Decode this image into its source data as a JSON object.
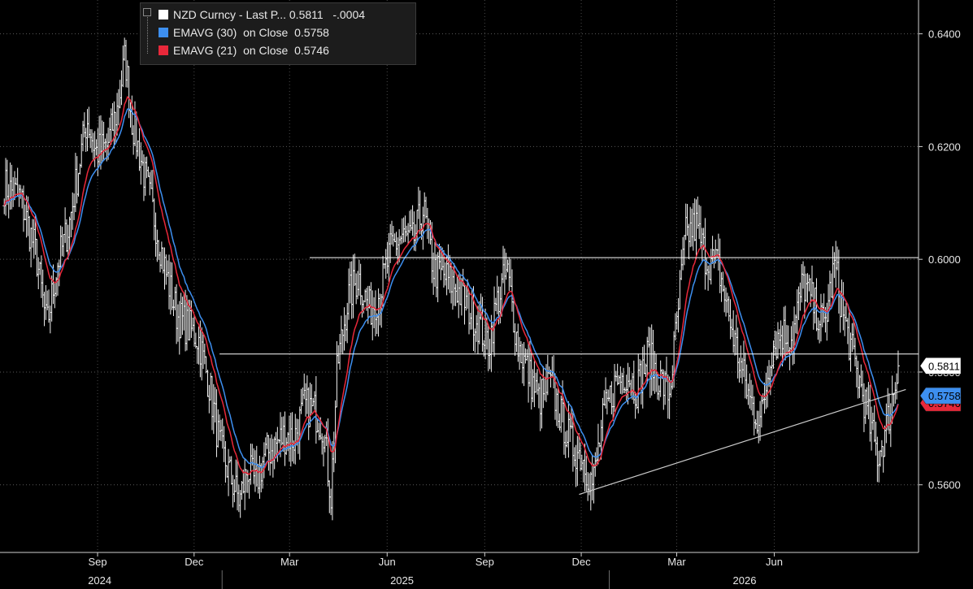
{
  "legend": {
    "items": [
      {
        "label": "NZD Curncy - Last P... 0.5811   -.0004",
        "color": "#ffffff"
      },
      {
        "label": "EMAVG (30)  on Close  0.5758",
        "color": "#3d8ff0"
      },
      {
        "label": "EMAVG (21)  on Close  0.5746",
        "color": "#e8283a"
      }
    ]
  },
  "chart_data": {
    "type": "line",
    "title": "",
    "xlabel": "",
    "ylabel": "",
    "ylim": [
      0.548,
      0.646
    ],
    "yticks": [
      "0.6400",
      "0.6200",
      "0.6000",
      "0.5800",
      "0.5600"
    ],
    "ytick_values": [
      0.64,
      0.62,
      0.6,
      0.58,
      0.56
    ],
    "xticks": [
      "Sep",
      "Dec",
      "Mar",
      "Jun",
      "Sep",
      "Dec",
      "Mar",
      "Jun"
    ],
    "years": [
      "2024",
      "2025",
      "2026"
    ],
    "grid": true,
    "last_labels": [
      {
        "text": "0.5811",
        "value": 0.5811,
        "bg": "#ffffff",
        "fg": "#000000"
      },
      {
        "text": "0.5758",
        "value": 0.5758,
        "bg": "#3d8ff0",
        "fg": "#000000"
      },
      {
        "text": "0.5746",
        "value": 0.5745,
        "bg": "#e8283a",
        "fg": "#000000"
      }
    ],
    "price_path": [
      [
        "2024-06-05",
        0.613
      ],
      [
        "2024-06-20",
        0.611
      ],
      [
        "2024-07-05",
        0.601
      ],
      [
        "2024-07-15",
        0.588
      ],
      [
        "2024-07-25",
        0.599
      ],
      [
        "2024-08-05",
        0.606
      ],
      [
        "2024-08-12",
        0.614
      ],
      [
        "2024-08-22",
        0.625
      ],
      [
        "2024-08-30",
        0.619
      ],
      [
        "2024-09-10",
        0.62
      ],
      [
        "2024-09-20",
        0.627
      ],
      [
        "2024-09-27",
        0.636
      ],
      [
        "2024-10-03",
        0.625
      ],
      [
        "2024-10-15",
        0.615
      ],
      [
        "2024-10-25",
        0.607
      ],
      [
        "2024-11-05",
        0.597
      ],
      [
        "2024-11-15",
        0.59
      ],
      [
        "2024-11-25",
        0.588
      ],
      [
        "2024-12-05",
        0.586
      ],
      [
        "2024-12-15",
        0.578
      ],
      [
        "2024-12-25",
        0.567
      ],
      [
        "2025-01-05",
        0.561
      ],
      [
        "2025-01-13",
        0.557
      ],
      [
        "2025-01-20",
        0.563
      ],
      [
        "2025-01-28",
        0.56
      ],
      [
        "2025-02-05",
        0.565
      ],
      [
        "2025-02-15",
        0.567
      ],
      [
        "2025-02-25",
        0.569
      ],
      [
        "2025-03-05",
        0.568
      ],
      [
        "2025-03-15",
        0.574
      ],
      [
        "2025-03-25",
        0.573
      ],
      [
        "2025-04-02",
        0.57
      ],
      [
        "2025-04-09",
        0.558
      ],
      [
        "2025-04-15",
        0.581
      ],
      [
        "2025-04-25",
        0.593
      ],
      [
        "2025-05-05",
        0.597
      ],
      [
        "2025-05-15",
        0.591
      ],
      [
        "2025-05-25",
        0.594
      ],
      [
        "2025-06-05",
        0.602
      ],
      [
        "2025-06-15",
        0.604
      ],
      [
        "2025-06-25",
        0.603
      ],
      [
        "2025-07-05",
        0.609
      ],
      [
        "2025-07-15",
        0.598
      ],
      [
        "2025-07-25",
        0.597
      ],
      [
        "2025-08-05",
        0.595
      ],
      [
        "2025-08-15",
        0.592
      ],
      [
        "2025-08-25",
        0.589
      ],
      [
        "2025-09-05",
        0.585
      ],
      [
        "2025-09-12",
        0.592
      ],
      [
        "2025-09-22",
        0.598
      ],
      [
        "2025-10-02",
        0.585
      ],
      [
        "2025-10-12",
        0.58
      ],
      [
        "2025-10-22",
        0.575
      ],
      [
        "2025-11-02",
        0.578
      ],
      [
        "2025-11-12",
        0.572
      ],
      [
        "2025-11-22",
        0.567
      ],
      [
        "2025-12-02",
        0.565
      ],
      [
        "2025-12-12",
        0.56
      ],
      [
        "2025-12-22",
        0.572
      ],
      [
        "2026-01-02",
        0.578
      ],
      [
        "2026-01-12",
        0.58
      ],
      [
        "2026-01-22",
        0.577
      ],
      [
        "2026-02-02",
        0.583
      ],
      [
        "2026-02-12",
        0.579
      ],
      [
        "2026-02-22",
        0.576
      ],
      [
        "2026-03-02",
        0.59
      ],
      [
        "2026-03-09",
        0.604
      ],
      [
        "2026-03-19",
        0.606
      ],
      [
        "2026-03-29",
        0.6
      ],
      [
        "2026-04-09",
        0.599
      ],
      [
        "2026-04-19",
        0.59
      ],
      [
        "2026-04-29",
        0.582
      ],
      [
        "2026-05-09",
        0.575
      ],
      [
        "2026-05-19",
        0.571
      ],
      [
        "2026-05-29",
        0.584
      ],
      [
        "2026-06-08",
        0.587
      ],
      [
        "2026-06-18",
        0.586
      ],
      [
        "2026-06-28",
        0.596
      ],
      [
        "2026-07-08",
        0.592
      ],
      [
        "2026-07-18",
        0.588
      ],
      [
        "2026-07-28",
        0.599
      ],
      [
        "2026-08-05",
        0.59
      ],
      [
        "2026-08-15",
        0.582
      ],
      [
        "2026-08-25",
        0.575
      ],
      [
        "2026-09-01",
        0.569
      ],
      [
        "2026-09-07",
        0.565
      ],
      [
        "2026-09-13",
        0.569
      ],
      [
        "2026-09-19",
        0.574
      ],
      [
        "2026-09-26",
        0.5811
      ]
    ],
    "hlines": [
      {
        "y": 0.6003,
        "from": "2025-03-20",
        "to": "2026-12-31",
        "color": "#ffffff"
      },
      {
        "y": 0.5832,
        "from": "2024-12-25",
        "to": "2026-12-31",
        "color": "#ffffff"
      }
    ],
    "trendline": {
      "from": [
        "2025-11-29",
        0.5583
      ],
      "to": [
        "2026-10-03",
        0.5769
      ],
      "color": "#cccccc"
    }
  }
}
